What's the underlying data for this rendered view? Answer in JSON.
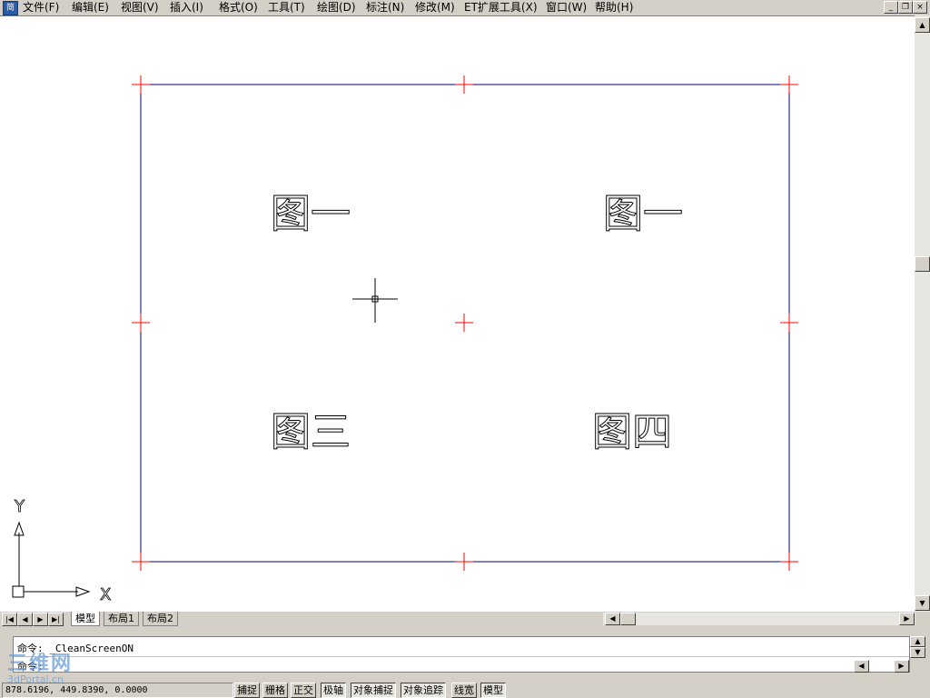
{
  "app": {
    "icon_text": "简"
  },
  "menu": [
    "文件(F)",
    "编辑(E)",
    "视图(V)",
    "插入(I)",
    "格式(O)",
    "工具(T)",
    "绘图(D)",
    "标注(N)",
    "修改(M)",
    "ET扩展工具(X)",
    "窗口(W)",
    "帮助(H)"
  ],
  "window_controls": {
    "minimize": "_",
    "restore": "❐",
    "close": "×"
  },
  "drawing": {
    "labels": [
      "图一",
      "图一",
      "图三",
      "图四"
    ],
    "frame_color": "#000080",
    "marker_color": "#ff0000",
    "ucs": {
      "x_label": "X",
      "y_label": "Y"
    }
  },
  "tabs": {
    "nav": [
      "|◀",
      "◀",
      "▶",
      "▶|"
    ],
    "items": [
      "模型",
      "布局1",
      "布局2"
    ],
    "active": "模型"
  },
  "command": {
    "history": "命令:  _CleanScreenON",
    "prompt": "命令:"
  },
  "status": {
    "coords": "878.6196, 449.8390, 0.0000",
    "toggles": [
      "捕捉",
      "栅格",
      "正交",
      "极轴",
      "对象捕捉",
      "对象追踪",
      "线宽",
      "模型"
    ]
  },
  "watermark": {
    "line1": "三维网",
    "line2": "3dPortal.cn"
  }
}
